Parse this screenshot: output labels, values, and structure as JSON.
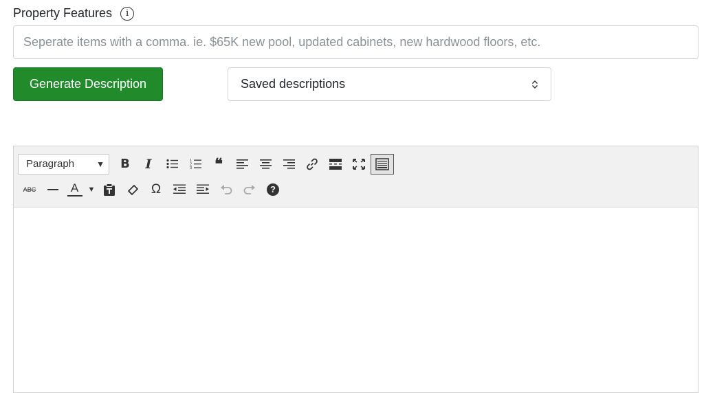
{
  "features": {
    "label": "Property Features",
    "info_icon": "info-circle-icon",
    "placeholder": "Seperate items with a comma. ie. $65K new pool, updated cabinets, new hardwood floors, etc.",
    "value": ""
  },
  "actions": {
    "generate_label": "Generate Description",
    "generate_color": "#218a2b",
    "saved_select_value": "Saved descriptions"
  },
  "editor": {
    "format_value": "Paragraph",
    "toolbar_row1": [
      "bold-icon",
      "italic-icon",
      "bullet-list-icon",
      "numbered-list-icon",
      "blockquote-icon",
      "align-left-icon",
      "align-center-icon",
      "align-right-icon",
      "link-icon",
      "read-more-icon",
      "fullscreen-icon",
      "toolbar-toggle-icon"
    ],
    "toolbar_row2": [
      "strikethrough-icon",
      "horizontal-line-icon",
      "text-color-icon",
      "paste-text-icon",
      "clear-formatting-icon",
      "special-character-icon",
      "outdent-icon",
      "indent-icon",
      "undo-icon",
      "redo-icon",
      "help-icon"
    ],
    "bold_glyph": "B",
    "italic_glyph": "I",
    "quote_glyph": "❝",
    "strike_glyph": "ABC",
    "text_color_glyph": "A",
    "omega_glyph": "Ω",
    "help_glyph": "?",
    "content": ""
  }
}
